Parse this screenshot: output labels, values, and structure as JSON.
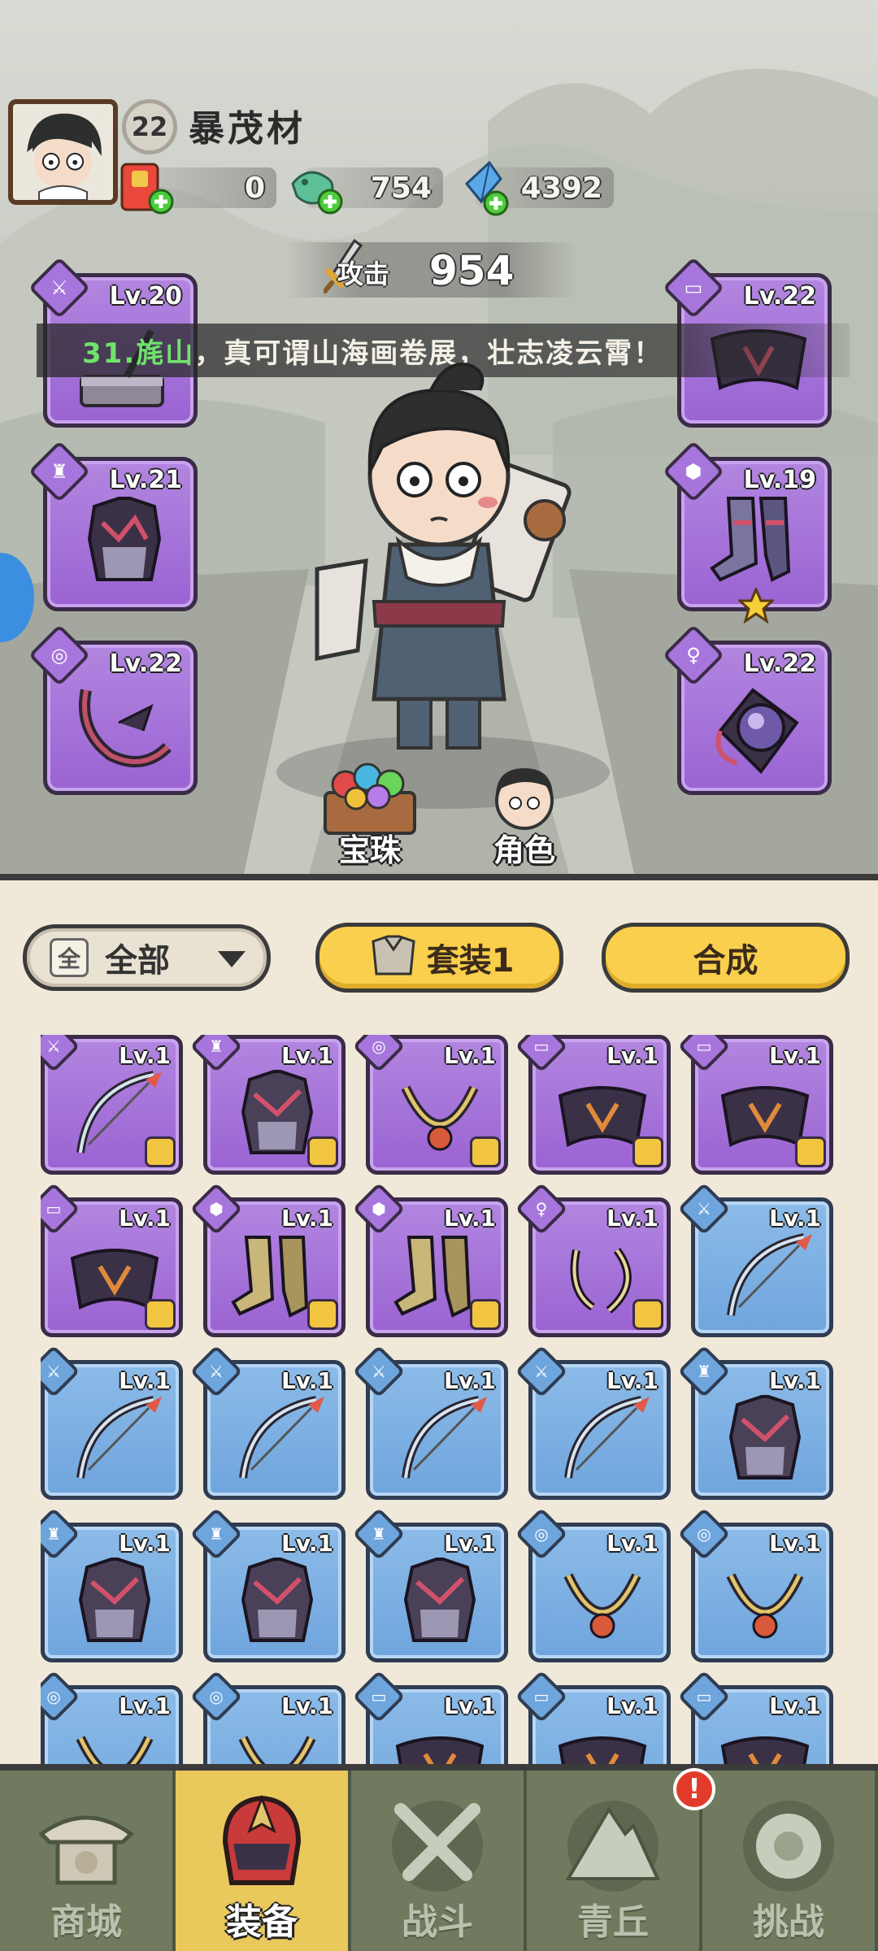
{
  "player": {
    "level": "22",
    "name": "暴茂材"
  },
  "currencies": [
    {
      "icon": "red-envelope-icon",
      "value": "0"
    },
    {
      "icon": "jade-fish-icon",
      "value": "754"
    },
    {
      "icon": "blue-crystal-icon",
      "value": "4392"
    }
  ],
  "attack": {
    "label": "攻击",
    "value": "954"
  },
  "banner": {
    "location": "31.旄山",
    "text": "，真可谓山海画卷展，壮志凌云霄！"
  },
  "equipped": {
    "weapon": {
      "level": "Lv.20"
    },
    "chest": {
      "level": "Lv.21"
    },
    "necklace": {
      "level": "Lv.22"
    },
    "belt": {
      "level": "Lv.22"
    },
    "boots": {
      "level": "Lv.19"
    },
    "ring": {
      "level": "Lv.22"
    }
  },
  "sub_buttons": {
    "orbs": "宝珠",
    "character": "角色"
  },
  "filter": {
    "box": "全",
    "label": "全部"
  },
  "set_button": "套装1",
  "compose_button": "合成",
  "inventory": [
    {
      "level": "Lv.1",
      "tier": "purple",
      "type": "weapon",
      "badge": true
    },
    {
      "level": "Lv.1",
      "tier": "purple",
      "type": "chest",
      "badge": true
    },
    {
      "level": "Lv.1",
      "tier": "purple",
      "type": "necklace",
      "badge": true
    },
    {
      "level": "Lv.1",
      "tier": "purple",
      "type": "belt",
      "badge": true
    },
    {
      "level": "Lv.1",
      "tier": "purple",
      "type": "belt",
      "badge": true
    },
    {
      "level": "Lv.1",
      "tier": "purple",
      "type": "belt",
      "badge": true
    },
    {
      "level": "Lv.1",
      "tier": "purple",
      "type": "boots",
      "badge": true
    },
    {
      "level": "Lv.1",
      "tier": "purple",
      "type": "boots",
      "badge": true
    },
    {
      "level": "Lv.1",
      "tier": "purple",
      "type": "ring",
      "badge": true
    },
    {
      "level": "Lv.1",
      "tier": "blue",
      "type": "weapon",
      "badge": false
    },
    {
      "level": "Lv.1",
      "tier": "blue",
      "type": "weapon",
      "badge": false
    },
    {
      "level": "Lv.1",
      "tier": "blue",
      "type": "weapon",
      "badge": false
    },
    {
      "level": "Lv.1",
      "tier": "blue",
      "type": "weapon",
      "badge": false
    },
    {
      "level": "Lv.1",
      "tier": "blue",
      "type": "weapon",
      "badge": false
    },
    {
      "level": "Lv.1",
      "tier": "blue",
      "type": "chest",
      "badge": false
    },
    {
      "level": "Lv.1",
      "tier": "blue",
      "type": "chest",
      "badge": false
    },
    {
      "level": "Lv.1",
      "tier": "blue",
      "type": "chest",
      "badge": false
    },
    {
      "level": "Lv.1",
      "tier": "blue",
      "type": "chest",
      "badge": false
    },
    {
      "level": "Lv.1",
      "tier": "blue",
      "type": "necklace",
      "badge": false
    },
    {
      "level": "Lv.1",
      "tier": "blue",
      "type": "necklace",
      "badge": false
    },
    {
      "level": "Lv.1",
      "tier": "blue",
      "type": "necklace",
      "badge": false
    },
    {
      "level": "Lv.1",
      "tier": "blue",
      "type": "necklace",
      "badge": false
    },
    {
      "level": "Lv.1",
      "tier": "blue",
      "type": "belt",
      "badge": false
    },
    {
      "level": "Lv.1",
      "tier": "blue",
      "type": "belt",
      "badge": false
    },
    {
      "level": "Lv.1",
      "tier": "blue",
      "type": "belt",
      "badge": false
    }
  ],
  "nav": [
    {
      "label": "商城",
      "icon": "shop-pagoda-icon",
      "active": false
    },
    {
      "label": "装备",
      "icon": "equipment-helmet-icon",
      "active": true
    },
    {
      "label": "战斗",
      "icon": "crossed-swords-icon",
      "active": false
    },
    {
      "label": "青丘",
      "icon": "mountain-icon",
      "active": false
    },
    {
      "label": "挑战",
      "icon": "challenge-disc-icon",
      "active": false
    }
  ],
  "notification": "!",
  "colors": {
    "purple_tier": "#9a63d2",
    "blue_tier": "#6fa5dd",
    "accent_yellow": "#f9cf4d",
    "nav_bg": "#6f7a5e"
  }
}
